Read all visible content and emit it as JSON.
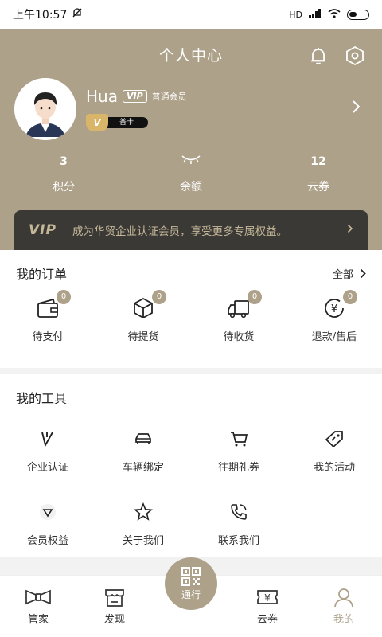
{
  "status": {
    "time": "上午10:57",
    "network": "HD"
  },
  "header": {
    "title": "个人中心"
  },
  "profile": {
    "name": "Hua",
    "vip_tag": "VIP",
    "level": "普通会员",
    "badge_letter": "V",
    "card": "普卡"
  },
  "stats": [
    {
      "value": "3",
      "label": "积分"
    },
    {
      "value": "",
      "label": "余额"
    },
    {
      "value": "12",
      "label": "云券"
    }
  ],
  "vip_banner": {
    "logo": "VIP",
    "text": "成为华贸企业认证会员，享受更多专属权益。"
  },
  "orders": {
    "title": "我的订单",
    "more": "全部",
    "items": [
      {
        "label": "待支付",
        "count": "0",
        "icon": "wallet-icon"
      },
      {
        "label": "待提货",
        "count": "0",
        "icon": "box-icon"
      },
      {
        "label": "待收货",
        "count": "0",
        "icon": "truck-icon"
      },
      {
        "label": "退款/售后",
        "count": "0",
        "icon": "refund-icon"
      }
    ]
  },
  "tools": {
    "title": "我的工具",
    "items": [
      {
        "label": "企业认证",
        "icon": "enterprise-v-icon"
      },
      {
        "label": "车辆绑定",
        "icon": "car-icon"
      },
      {
        "label": "往期礼券",
        "icon": "cart-icon"
      },
      {
        "label": "我的活动",
        "icon": "tag-icon"
      },
      {
        "label": "会员权益",
        "icon": "diamond-icon"
      },
      {
        "label": "关于我们",
        "icon": "star-icon"
      },
      {
        "label": "联系我们",
        "icon": "phone-icon"
      }
    ]
  },
  "tabbar": {
    "items": [
      {
        "label": "管家",
        "icon": "bowtie-icon"
      },
      {
        "label": "发现",
        "icon": "store-icon"
      },
      {
        "label": "云券",
        "icon": "coupon-icon"
      },
      {
        "label": "我的",
        "icon": "user-icon"
      }
    ],
    "center": {
      "label": "通行",
      "icon": "qr-icon"
    }
  },
  "colors": {
    "accent": "#ada18a",
    "vip_bar": "#3b3936",
    "vip_text": "#c5b899"
  }
}
